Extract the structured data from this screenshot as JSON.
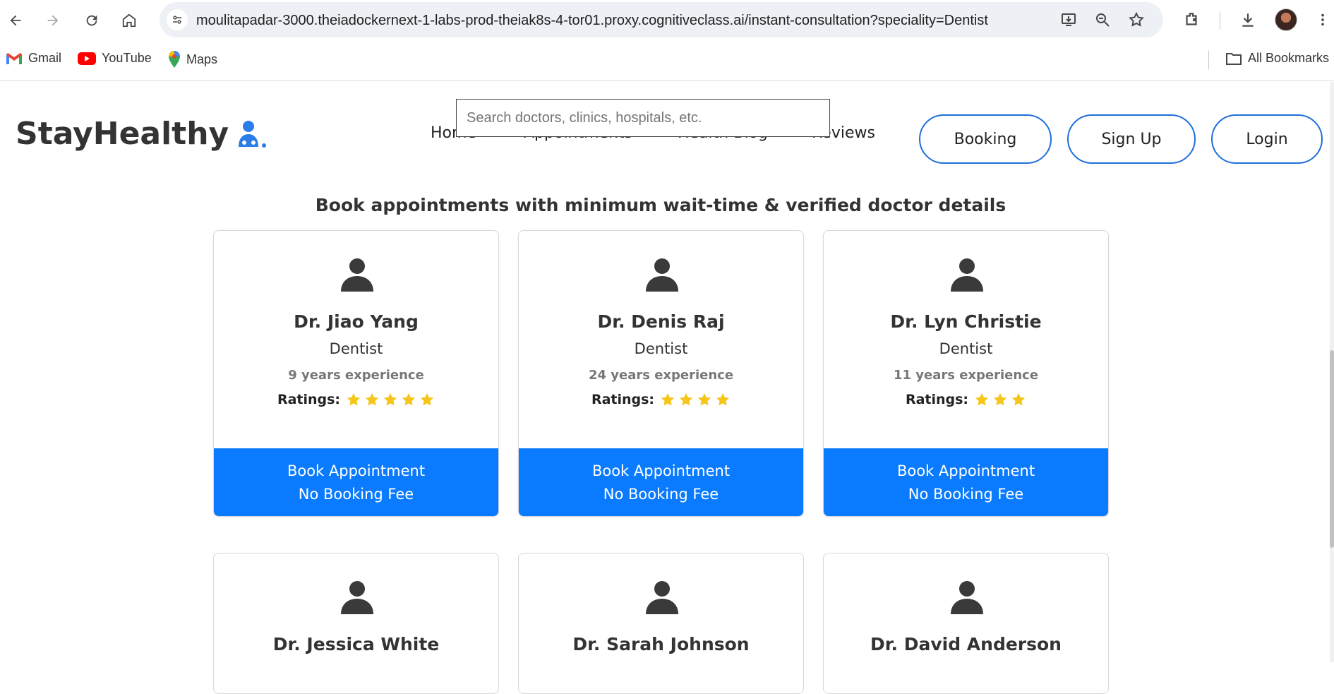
{
  "browser": {
    "url": "moulitapadar-3000.theiadockernext-1-labs-prod-theiak8s-4-tor01.proxy.cognitiveclass.ai/instant-consultation?speciality=Dentist",
    "bookmarks": [
      {
        "label": "Gmail",
        "icon": "gmail-icon"
      },
      {
        "label": "YouTube",
        "icon": "youtube-icon"
      },
      {
        "label": "Maps",
        "icon": "maps-icon"
      }
    ],
    "all_bookmarks": "All Bookmarks"
  },
  "header": {
    "logo_text": "StayHealthy",
    "search_placeholder": "Search doctors, clinics, hospitals, etc.",
    "nav": [
      "Home",
      "Appointments",
      "Health Blog",
      "Reviews"
    ],
    "buttons": {
      "booking": "Booking",
      "signup": "Sign Up",
      "login": "Login"
    }
  },
  "heading": "Book appointments with minimum wait-time & verified doctor details",
  "doctors": [
    {
      "name": "Dr. Jiao Yang",
      "speciality": "Dentist",
      "experience": "9 years experience",
      "ratings_label": "Ratings:",
      "stars": 5,
      "book_line1": "Book Appointment",
      "book_line2": "No Booking Fee"
    },
    {
      "name": "Dr. Denis Raj",
      "speciality": "Dentist",
      "experience": "24 years experience",
      "ratings_label": "Ratings:",
      "stars": 4,
      "book_line1": "Book Appointment",
      "book_line2": "No Booking Fee"
    },
    {
      "name": "Dr. Lyn Christie",
      "speciality": "Dentist",
      "experience": "11 years experience",
      "ratings_label": "Ratings:",
      "stars": 3,
      "book_line1": "Book Appointment",
      "book_line2": "No Booking Fee"
    }
  ],
  "doctors_row2": [
    {
      "name": "Dr. Jessica White"
    },
    {
      "name": "Dr. Sarah Johnson"
    },
    {
      "name": "Dr. David Anderson"
    }
  ],
  "colors": {
    "accent": "#0a7bff",
    "pill_border": "#1e6fd9",
    "star": "#f5c518",
    "logo_icon": "#2b7de9"
  }
}
